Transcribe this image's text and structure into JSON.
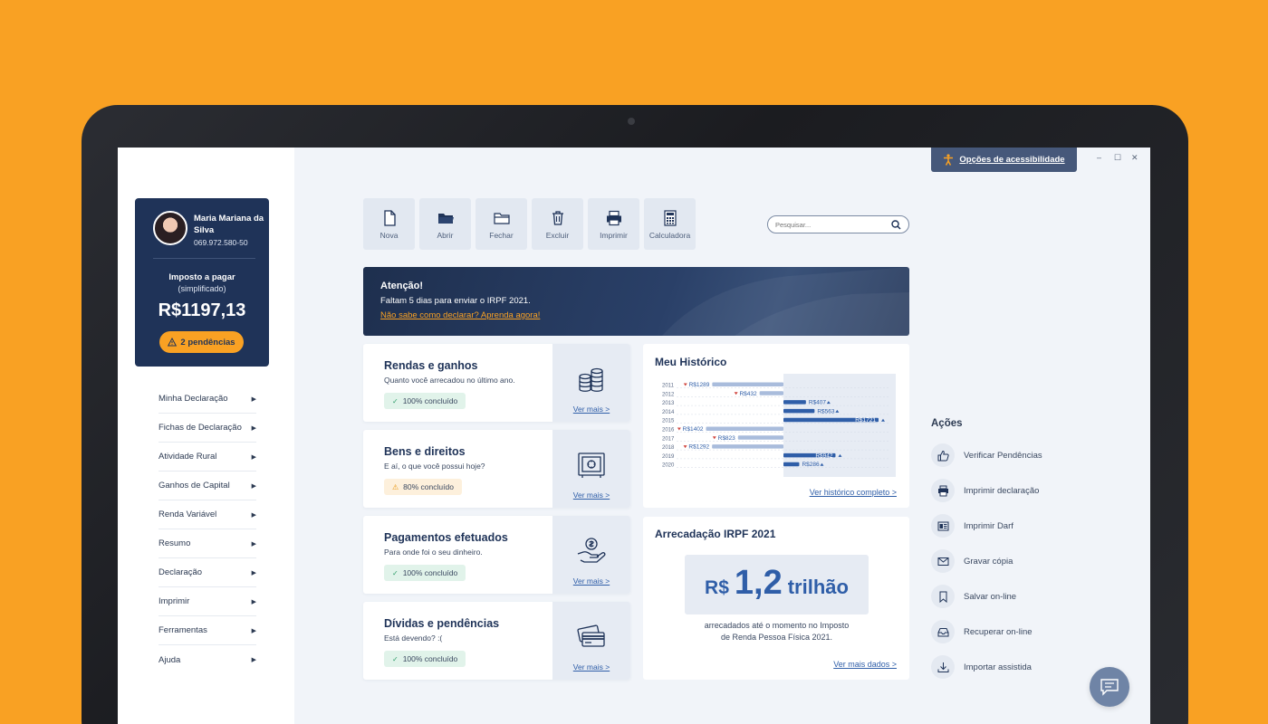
{
  "profile": {
    "name": "Maria Mariana da Silva",
    "cpf": "069.972.580-50",
    "tax_label": "Imposto a pagar",
    "tax_sub": "(simplificado)",
    "tax_value": "R$1197,13",
    "pending_label": "2 pendências"
  },
  "sidebar": {
    "items": [
      {
        "label": "Minha Declaração"
      },
      {
        "label": "Fichas de Declaração"
      },
      {
        "label": "Atividade Rural"
      },
      {
        "label": "Ganhos de Capital"
      },
      {
        "label": "Renda Variável"
      },
      {
        "label": "Resumo"
      },
      {
        "label": "Declaração"
      },
      {
        "label": "Imprimir"
      },
      {
        "label": "Ferramentas"
      },
      {
        "label": "Ajuda"
      }
    ]
  },
  "toolbar": {
    "new": "Nova",
    "open": "Abrir",
    "close": "Fechar",
    "delete": "Excluir",
    "print": "Imprimir",
    "calculator": "Calculadora"
  },
  "search": {
    "placeholder": "Pesquisar..."
  },
  "accessibility": {
    "label": "Opções de acessibilidade"
  },
  "banner": {
    "title": "Atenção!",
    "text": "Faltam 5 dias para enviar o IRPF 2021.",
    "link": "Não sabe como declarar? Aprenda agora!"
  },
  "cards": [
    {
      "title": "Rendas e ganhos",
      "subtitle": "Quanto você arrecadou no último ano.",
      "status": "100% concluído",
      "more": "Ver mais >"
    },
    {
      "title": "Bens e direitos",
      "subtitle": "E aí, o que você possui hoje?",
      "status": "80% concluído",
      "more": "Ver mais >"
    },
    {
      "title": "Pagamentos efetuados",
      "subtitle": "Para onde foi o seu dinheiro.",
      "status": "100% concluído",
      "more": "Ver mais >"
    },
    {
      "title": "Dívidas e pendências",
      "subtitle": "Está devendo? :(",
      "status": "100% concluído",
      "more": "Ver mais >"
    }
  ],
  "history": {
    "title": "Meu Histórico",
    "link": "Ver histórico completo >"
  },
  "chart_data": {
    "type": "bar",
    "categories": [
      "2011",
      "2012",
      "2013",
      "2014",
      "2015",
      "2016",
      "2017",
      "2018",
      "2019",
      "2020"
    ],
    "values": [
      -1289,
      -432,
      407,
      563,
      1721,
      -1402,
      -823,
      -1292,
      942,
      286
    ],
    "labels": [
      "R$1289",
      "R$432",
      "R$407",
      "R$563",
      "R$1721",
      "R$1402",
      "R$823",
      "R$1292",
      "R$942",
      "R$286"
    ],
    "colors": {
      "negative": "#a9bcdc",
      "positive": "#2f5ea8"
    }
  },
  "revenue": {
    "title": "Arrecadação IRPF 2021",
    "currency": "R$",
    "amount": "1,2",
    "unit": "trilhão",
    "description_line1": "arrecadados até o momento no Imposto",
    "description_line2": "de Renda Pessoa Física 2021.",
    "link": "Ver mais dados >"
  },
  "actions": {
    "title": "Ações",
    "items": [
      {
        "label": "Verificar Pendências",
        "icon": "thumbs-up-icon"
      },
      {
        "label": "Imprimir declaração",
        "icon": "printer-icon"
      },
      {
        "label": "Imprimir Darf",
        "icon": "document-icon"
      },
      {
        "label": "Gravar cópia",
        "icon": "mail-icon"
      },
      {
        "label": "Salvar on-line",
        "icon": "bookmark-icon"
      },
      {
        "label": "Recuperar on-line",
        "icon": "inbox-icon"
      },
      {
        "label": "Importar assistida",
        "icon": "download-icon"
      }
    ]
  }
}
